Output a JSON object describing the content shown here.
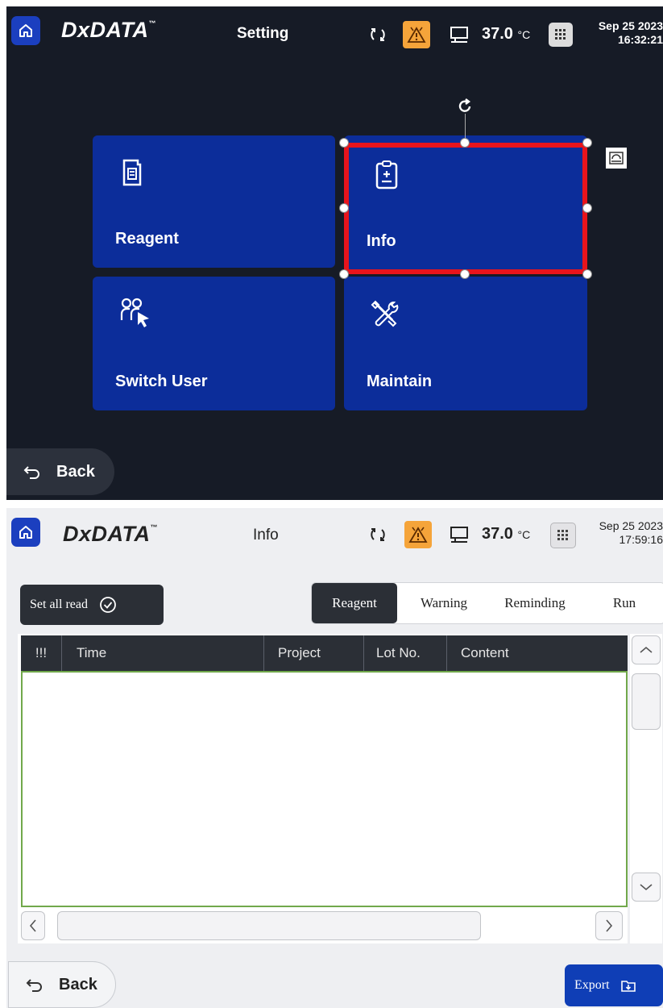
{
  "setting_screen": {
    "brand": "DxDATA",
    "brand_mark": "™",
    "title": "Setting",
    "temperature": "37.0",
    "temperature_unit": "°C",
    "date": "Sep 25 2023",
    "time": "16:32:21",
    "tiles": [
      {
        "label": "Reagent",
        "icon": "reagent-bottle-icon"
      },
      {
        "label": "Info",
        "icon": "clipboard-info-icon"
      },
      {
        "label": "Switch User",
        "icon": "switch-user-icon"
      },
      {
        "label": "Maintain",
        "icon": "wrench-screwdriver-icon"
      }
    ],
    "selected_tile": "Info",
    "back_label": "Back"
  },
  "info_screen": {
    "brand": "DxDATA",
    "brand_mark": "™",
    "title": "Info",
    "temperature": "37.0",
    "temperature_unit": "°C",
    "date": "Sep 25 2023",
    "time": "17:59:16",
    "set_all_read_label": "Set all read",
    "tabs": [
      {
        "label": "Reagent",
        "active": true
      },
      {
        "label": "Warning",
        "active": false
      },
      {
        "label": "Reminding",
        "active": false
      },
      {
        "label": "Run",
        "active": false
      }
    ],
    "table": {
      "columns": [
        "!!!",
        "Time",
        "Project",
        "Lot No.",
        "Content"
      ],
      "rows": []
    },
    "back_label": "Back",
    "export_label": "Export"
  },
  "colors": {
    "tile_blue": "#0c2d9a",
    "home_blue": "#1b3fbf",
    "warning_orange": "#f5a43a",
    "selection_red": "#e8141c",
    "table_border_green": "#71a84b",
    "export_blue": "#0f3eb6"
  }
}
